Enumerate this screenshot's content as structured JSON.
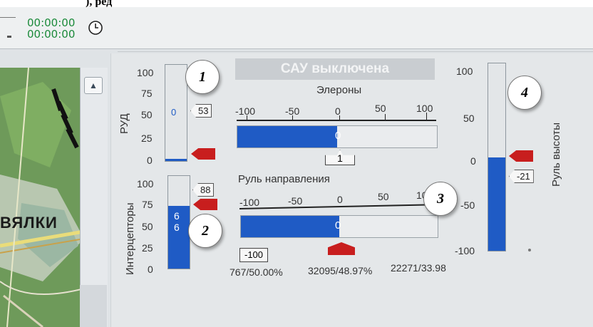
{
  "top_text": "), ред",
  "timer": {
    "line1": "00:00:00",
    "line2": "00:00:00"
  },
  "icons": {
    "clock": "clock-icon",
    "scroll_up": "chevron-up-icon"
  },
  "map_label": "ВЯЛКИ",
  "sau_status": "САУ выключена",
  "rud": {
    "label": "РУД",
    "ticks": [
      "100",
      "75",
      "50",
      "25",
      "0"
    ],
    "value_text": "0",
    "tag": "53",
    "fill_fraction": 0.02
  },
  "interceptors": {
    "label": "Интерцепторы",
    "ticks": [
      "100",
      "75",
      "50",
      "25",
      "0"
    ],
    "value_text_1": "6",
    "value_text_2": "6",
    "tag": "88",
    "fill_fraction": 0.68
  },
  "ailerons": {
    "label": "Элероны",
    "ticks": [
      "-100",
      "-50",
      "0",
      "50",
      "100"
    ],
    "tag": "1",
    "value": -100
  },
  "rudder": {
    "label": "Руль направления",
    "ticks": [
      "-100",
      "-50",
      "0",
      "50",
      "100"
    ],
    "tag": "-100",
    "value": -100
  },
  "elevator": {
    "label": "Руль высоты",
    "ticks": [
      "100",
      "50",
      "0",
      "-50",
      "-100"
    ],
    "tag": "-21",
    "value": -100
  },
  "stats": [
    "767/50.00%",
    "32095/48.97%",
    "22271/33.98"
  ],
  "callouts": [
    "1",
    "2",
    "3",
    "4"
  ],
  "colors": {
    "fill": "#1f5bc5",
    "marker": "#c81e1e",
    "timer": "#1b8a3a"
  }
}
